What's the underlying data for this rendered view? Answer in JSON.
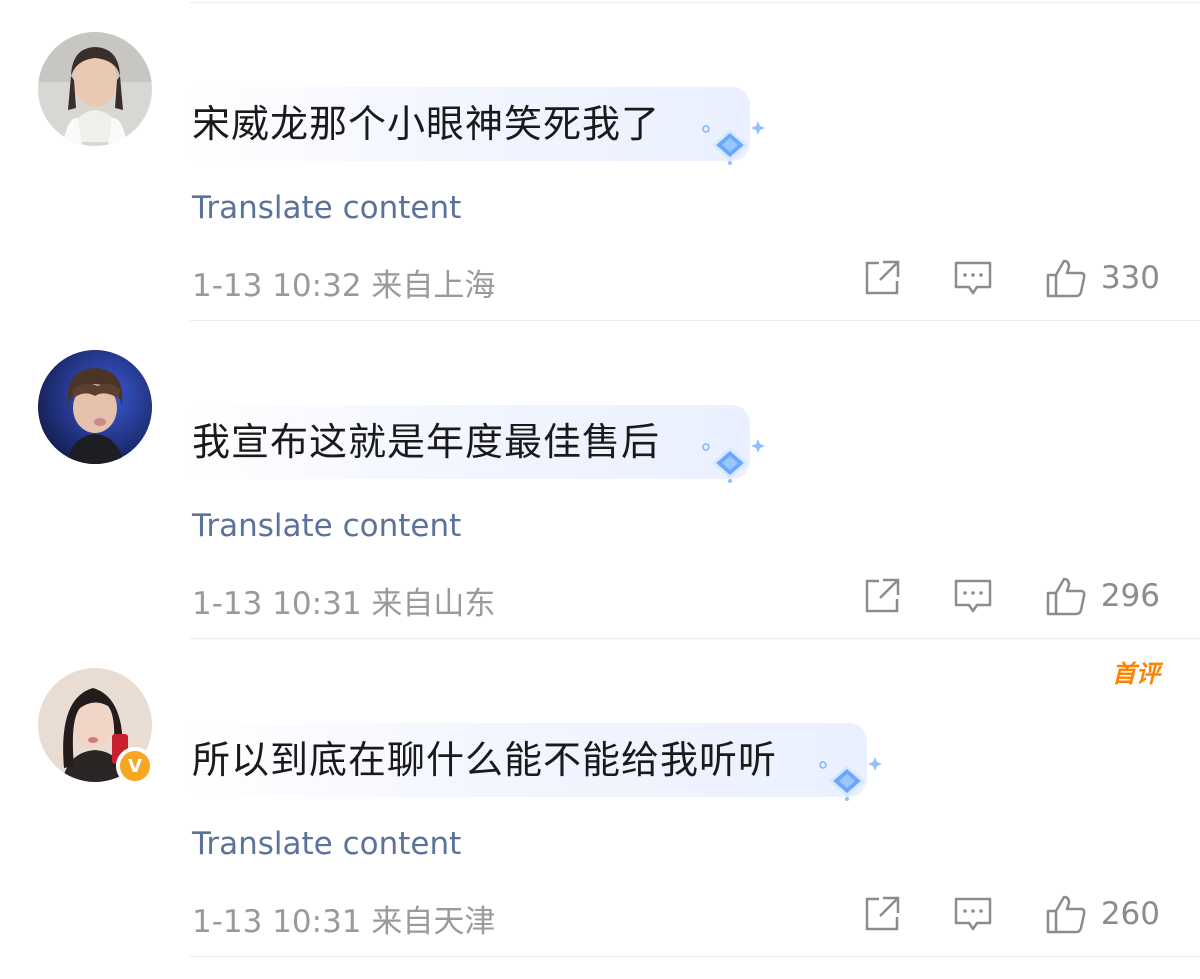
{
  "colors": {
    "accent_link": "#5b7399",
    "meta_gray": "#9a9a9a",
    "first_badge": "#ff8200",
    "verified_badge": "#f5a623"
  },
  "translate_label": "Translate content",
  "comments": [
    {
      "text": "宋威龙那个小眼神笑死我了",
      "time": "1-13 10:32",
      "location": "来自上海",
      "likes": "330",
      "avatar_icon": "user-avatar-icon",
      "verified": false,
      "first_comment": false
    },
    {
      "text": "我宣布这就是年度最佳售后",
      "time": "1-13 10:31",
      "location": "来自山东",
      "likes": "296",
      "avatar_icon": "user-avatar-icon",
      "verified": false,
      "first_comment": false
    },
    {
      "text": "所以到底在聊什么能不能给我听听",
      "time": "1-13 10:31",
      "location": "来自天津",
      "likes": "260",
      "avatar_icon": "user-avatar-icon",
      "verified": true,
      "verified_label": "V",
      "first_comment": true,
      "first_comment_label": "首评"
    }
  ],
  "icons": {
    "share": "share-icon",
    "reply": "reply-icon",
    "like": "thumbs-up-icon",
    "gem": "diamond-gem-icon"
  }
}
